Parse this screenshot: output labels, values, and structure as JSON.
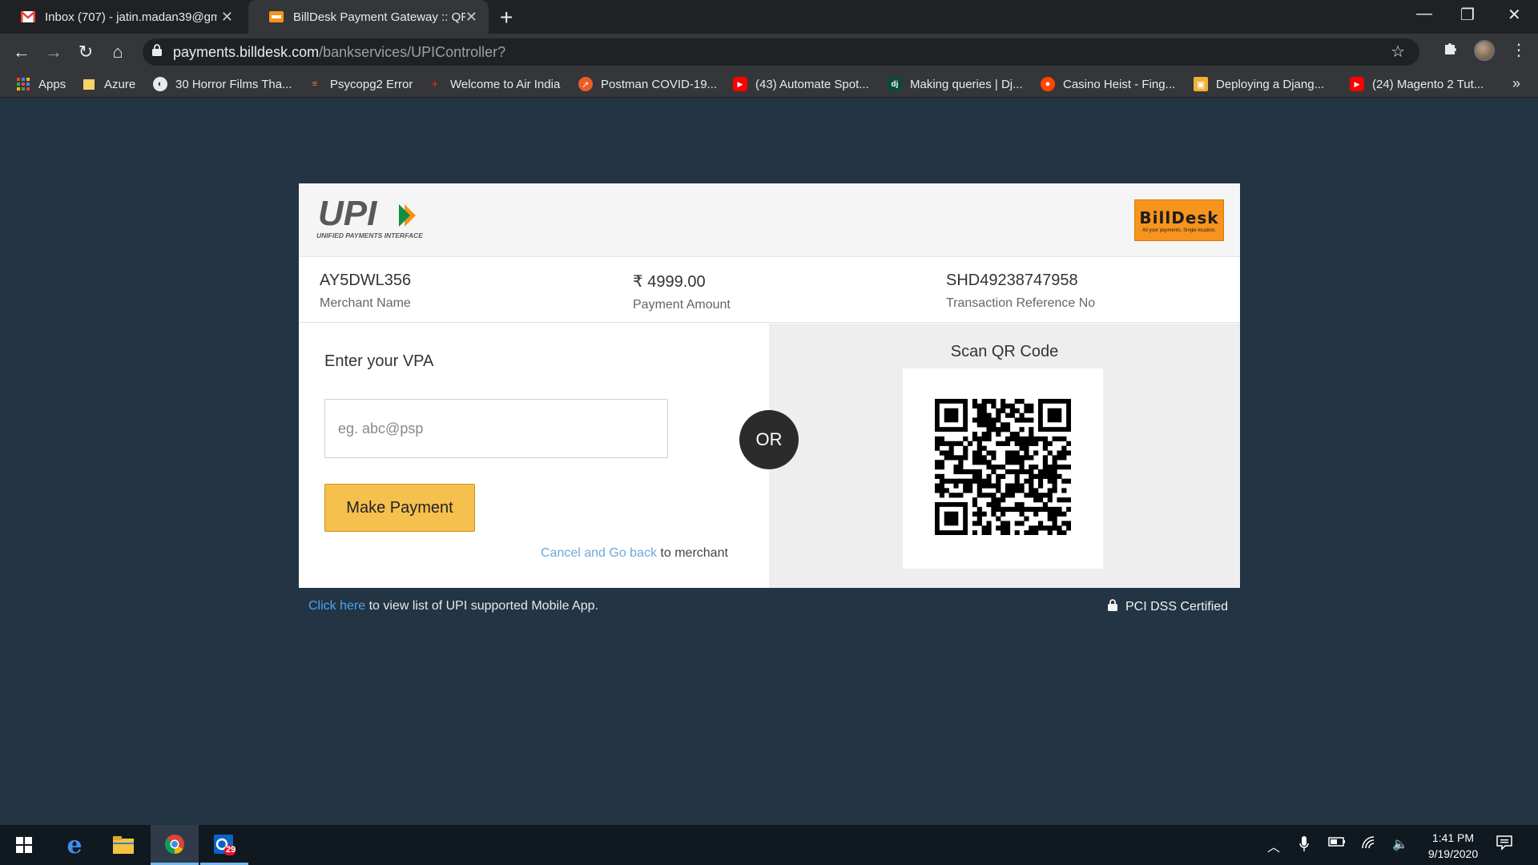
{
  "browser": {
    "tabs": [
      {
        "title": "Inbox (707) - jatin.madan39@gm",
        "icon": "gmail-icon",
        "active": false
      },
      {
        "title": "BillDesk Payment Gateway :: QRC",
        "icon": "billdesk-favicon",
        "active": true
      }
    ],
    "url_host": "payments.billdesk.com",
    "url_path": "/bankservices/UPIController?",
    "bookmarks": [
      {
        "label": "Apps",
        "icon": "apps-grid-icon",
        "color": "#ea4335"
      },
      {
        "label": "Azure",
        "icon": "folder-icon",
        "color": "#f6d365"
      },
      {
        "label": "30 Horror Films Tha...",
        "icon": "globe-icon",
        "color": "#e8eaed"
      },
      {
        "label": "Psycopg2 Error",
        "icon": "stackoverflow-icon",
        "color": "#f48024"
      },
      {
        "label": "Welcome to Air India",
        "icon": "airindia-icon",
        "color": "#d32f2f"
      },
      {
        "label": "Postman COVID-19...",
        "icon": "postman-icon",
        "color": "#ef5b25"
      },
      {
        "label": "(43) Automate Spot...",
        "icon": "youtube-icon",
        "color": "#ff0000"
      },
      {
        "label": "Making queries | Dj...",
        "icon": "django-icon",
        "color": "#0c4b33"
      },
      {
        "label": "Casino Heist - Fing...",
        "icon": "reddit-icon",
        "color": "#ff4500"
      },
      {
        "label": "Deploying a Djang...",
        "icon": "package-icon",
        "color": "#f2b134"
      },
      {
        "label": "(24) Magento 2 Tut...",
        "icon": "youtube-icon",
        "color": "#ff0000"
      }
    ],
    "more": "»"
  },
  "payment": {
    "logo_text": "UPI",
    "logo_sub": "UNIFIED PAYMENTS INTERFACE",
    "billdesk_name": "BillDesk",
    "billdesk_tagline": "All your payments. Single location.",
    "merchant_name": "AY5DWL356",
    "merchant_label": "Merchant Name",
    "amount": "₹ 4999.00",
    "amount_label": "Payment Amount",
    "txn_ref": "SHD49238747958",
    "txn_label": "Transaction Reference No",
    "vpa_label": "Enter your VPA",
    "vpa_placeholder": "eg. abc@psp",
    "vpa_value": "",
    "pay_button": "Make Payment",
    "cancel_link": "Cancel and Go back",
    "cancel_suffix": " to merchant",
    "or_text": "OR",
    "scan_label": "Scan QR Code"
  },
  "footer": {
    "link": "Click here",
    "text": " to view list of UPI supported Mobile App.",
    "pci": "PCI DSS Certified"
  },
  "taskbar": {
    "apps": [
      "windows-start",
      "edge",
      "file-explorer",
      "chrome",
      "outlook"
    ],
    "outlook_badge": "29",
    "time": "1:41 PM",
    "date": "9/19/2020"
  },
  "colors": {
    "page_bg": "#233444",
    "pay_button": "#f5c04e",
    "link": "#6fa8dc",
    "billdesk_orange": "#f7941d"
  }
}
